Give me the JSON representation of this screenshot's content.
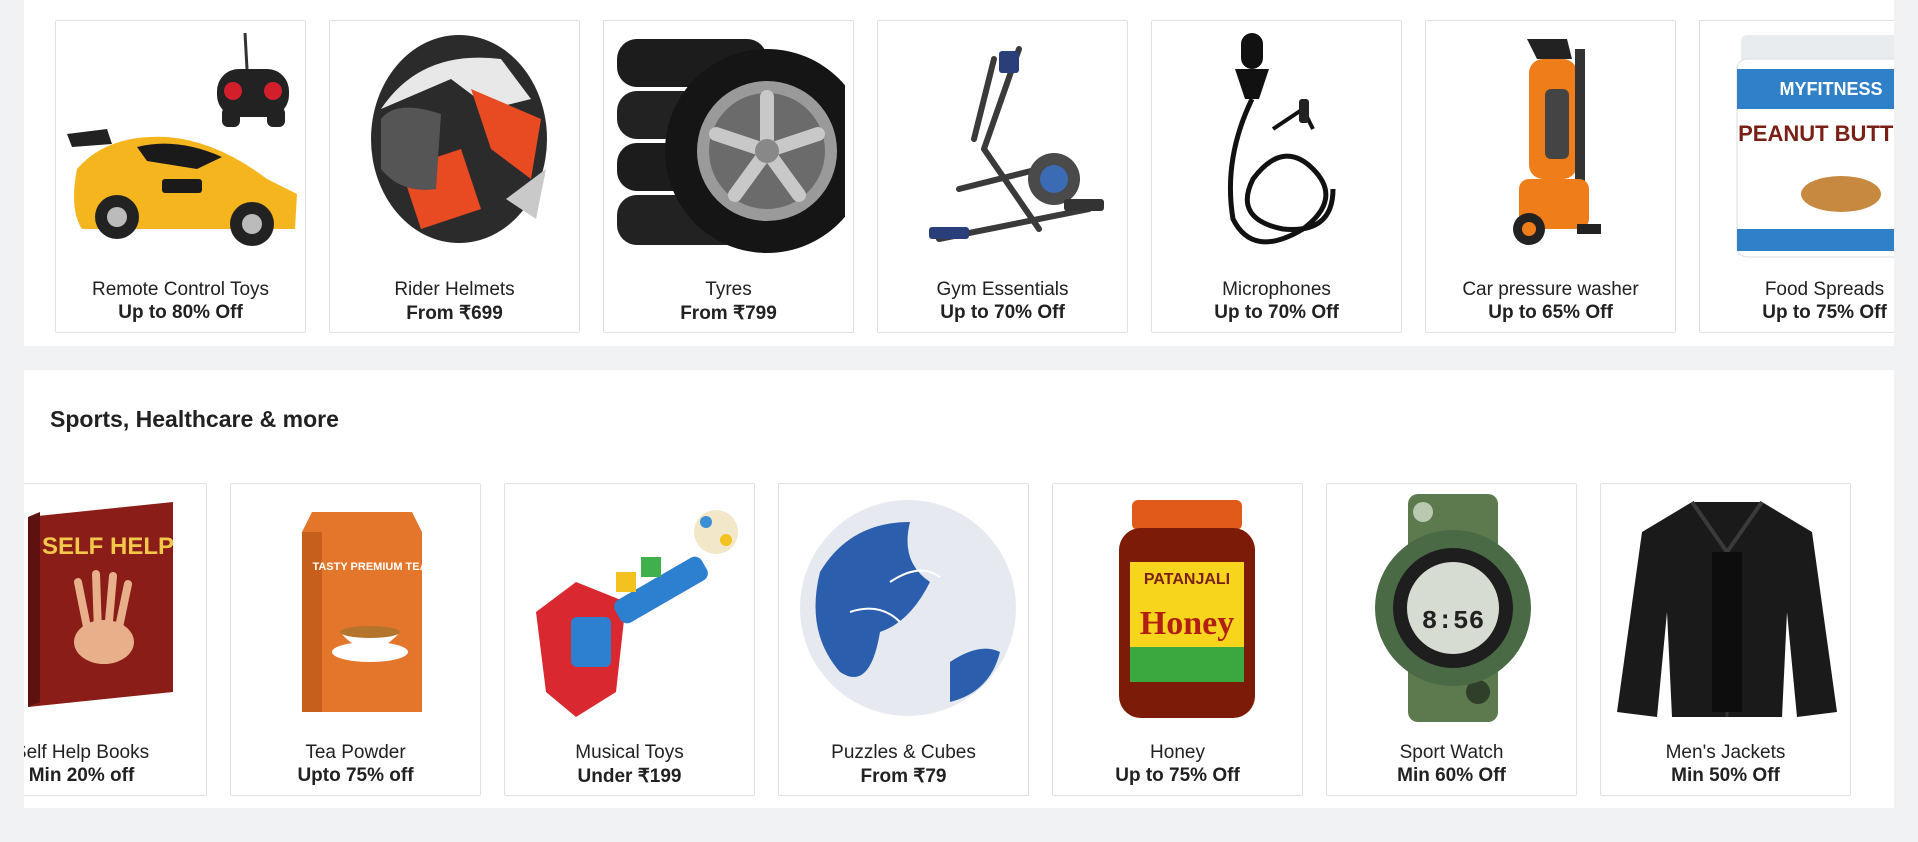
{
  "top_row": {
    "cards": [
      {
        "name": "Remote Control Toys",
        "offer": "Up to 80% Off",
        "icon": "rc-car-icon"
      },
      {
        "name": "Rider Helmets",
        "offer": "From ₹699",
        "icon": "helmet-icon"
      },
      {
        "name": "Tyres",
        "offer": "From ₹799",
        "icon": "tyre-icon"
      },
      {
        "name": "Gym Essentials",
        "offer": "Up to 70% Off",
        "icon": "elliptical-trainer-icon"
      },
      {
        "name": "Microphones",
        "offer": "Up to 70% Off",
        "icon": "lapel-microphone-icon"
      },
      {
        "name": "Car pressure washer",
        "offer": "Up to 65% Off",
        "icon": "pressure-washer-icon"
      },
      {
        "name": "Food Spreads",
        "offer": "Up to 75% Off",
        "icon": "peanut-butter-jar-icon",
        "label_brand": "MYFITNESS",
        "label_product": "PEANUT BUTTER"
      }
    ]
  },
  "sports_section": {
    "title": "Sports, Healthcare & more",
    "cards": [
      {
        "name": "Self Help Books",
        "offer": "Min 20% off",
        "icon": "book-icon",
        "cover_title": "SELF HELP"
      },
      {
        "name": "Tea Powder",
        "offer": "Upto 75% off",
        "icon": "tea-pack-icon",
        "pack_label": "TASTY PREMIUM TEA"
      },
      {
        "name": "Musical Toys",
        "offer": "Under ₹199",
        "icon": "toy-guitar-icon"
      },
      {
        "name": "Puzzles & Cubes",
        "offer": "From ₹79",
        "icon": "globe-puzzle-icon"
      },
      {
        "name": "Honey",
        "offer": "Up to 75% Off",
        "icon": "honey-jar-icon",
        "jar_brand": "PATANJALI",
        "jar_product": "Honey"
      },
      {
        "name": "Sport Watch",
        "offer": "Min 60% Off",
        "icon": "sport-watch-icon",
        "watch_time": "8:56"
      },
      {
        "name": "Men's Jackets",
        "offer": "Min 50% Off",
        "icon": "leather-jacket-icon"
      }
    ]
  },
  "colors": {
    "page_bg": "#f1f2f4",
    "card_border": "#e0e0e0",
    "text": "#212121"
  }
}
